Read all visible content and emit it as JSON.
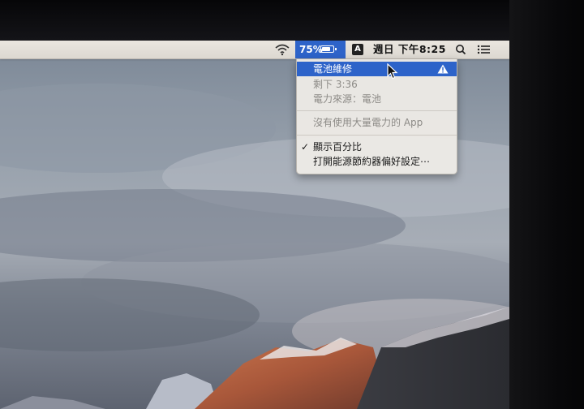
{
  "menubar": {
    "wifi_icon": "wifi-icon",
    "battery": {
      "percent_label": "75%",
      "level": 0.75,
      "highlight": "#2d63c9"
    },
    "input_source": "A",
    "clock": "週日 下午8:25",
    "spotlight_icon": "search-icon",
    "notification_icon": "list-icon"
  },
  "battery_menu": {
    "items": [
      {
        "label": "電池維修",
        "state": "selected",
        "icon": "warning-icon"
      },
      {
        "label": "剩下 3:36",
        "state": "disabled"
      },
      {
        "label": "電力來源：電池",
        "state": "disabled"
      },
      {
        "label": "沒有使用大量電力的 App",
        "state": "disabled"
      },
      {
        "label": "顯示百分比",
        "state": "checked"
      },
      {
        "label": "打開能源節約器偏好設定⋯",
        "state": "enabled"
      }
    ]
  }
}
